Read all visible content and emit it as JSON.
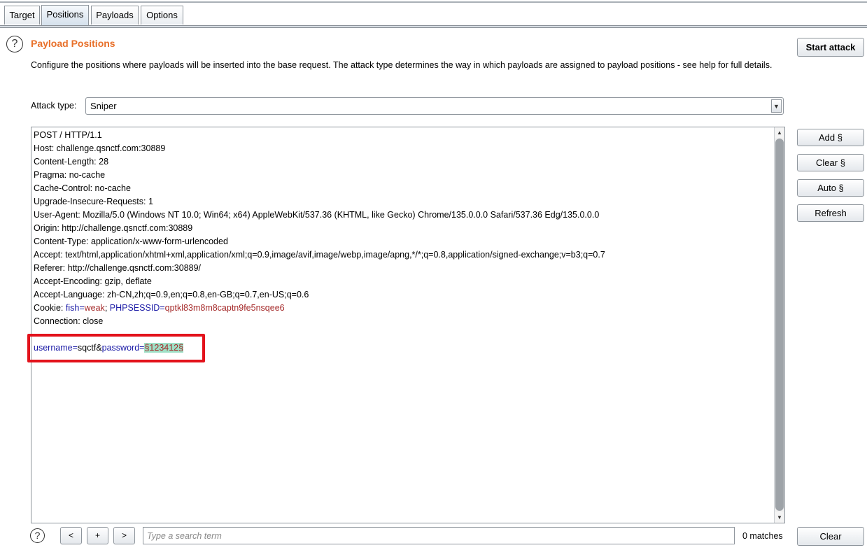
{
  "tabs": [
    {
      "label": "Target",
      "active": false
    },
    {
      "label": "Positions",
      "active": true
    },
    {
      "label": "Payloads",
      "active": false
    },
    {
      "label": "Options",
      "active": false
    }
  ],
  "header": {
    "title": "Payload Positions",
    "description": "Configure the positions where payloads will be inserted into the base request. The attack type determines the way in which payloads are assigned to payload positions - see help for full details.",
    "start_attack_label": "Start attack",
    "help_icon": "question-circle-icon"
  },
  "attack_type": {
    "label": "Attack type:",
    "selected": "Sniper"
  },
  "request": {
    "lines": [
      "POST / HTTP/1.1",
      "Host: challenge.qsnctf.com:30889",
      "Content-Length: 28",
      "Pragma: no-cache",
      "Cache-Control: no-cache",
      "Upgrade-Insecure-Requests: 1",
      "User-Agent: Mozilla/5.0 (Windows NT 10.0; Win64; x64) AppleWebKit/537.36 (KHTML, like Gecko) Chrome/135.0.0.0 Safari/537.36 Edg/135.0.0.0",
      "Origin: http://challenge.qsnctf.com:30889",
      "Content-Type: application/x-www-form-urlencoded",
      "Accept: text/html,application/xhtml+xml,application/xml;q=0.9,image/avif,image/webp,image/apng,*/*;q=0.8,application/signed-exchange;v=b3;q=0.7",
      "Referer: http://challenge.qsnctf.com:30889/",
      "Accept-Encoding: gzip, deflate",
      "Accept-Language: zh-CN,zh;q=0.9,en;q=0.8,en-GB;q=0.7,en-US;q=0.6"
    ],
    "cookie": {
      "prefix": "Cookie: ",
      "k1": "fish",
      "eq1": "=",
      "v1": "weak",
      "sep": "; ",
      "k2": "PHPSESSID",
      "eq2": "=",
      "v2": "qptkl83m8m8captn9fe5nsqee6"
    },
    "connection": "Connection: close",
    "body": {
      "k1": "username",
      "eq1": "=",
      "v1": "sqctf",
      "amp": "&",
      "k2": "password",
      "eq2": "=",
      "payload": "§123412§"
    }
  },
  "side_buttons": {
    "add": "Add §",
    "clear": "Clear §",
    "auto": "Auto §",
    "refresh": "Refresh"
  },
  "search": {
    "prev": "<",
    "add": "+",
    "next": ">",
    "placeholder": "Type a search term",
    "matches": "0 matches",
    "clear": "Clear",
    "help_icon": "question-circle-icon"
  },
  "colors": {
    "title": "#e8702a",
    "key": "#1a1aa6",
    "value": "#a52a2a",
    "payload_bg": "#9fe0c6",
    "highlight": "#e3121b"
  }
}
